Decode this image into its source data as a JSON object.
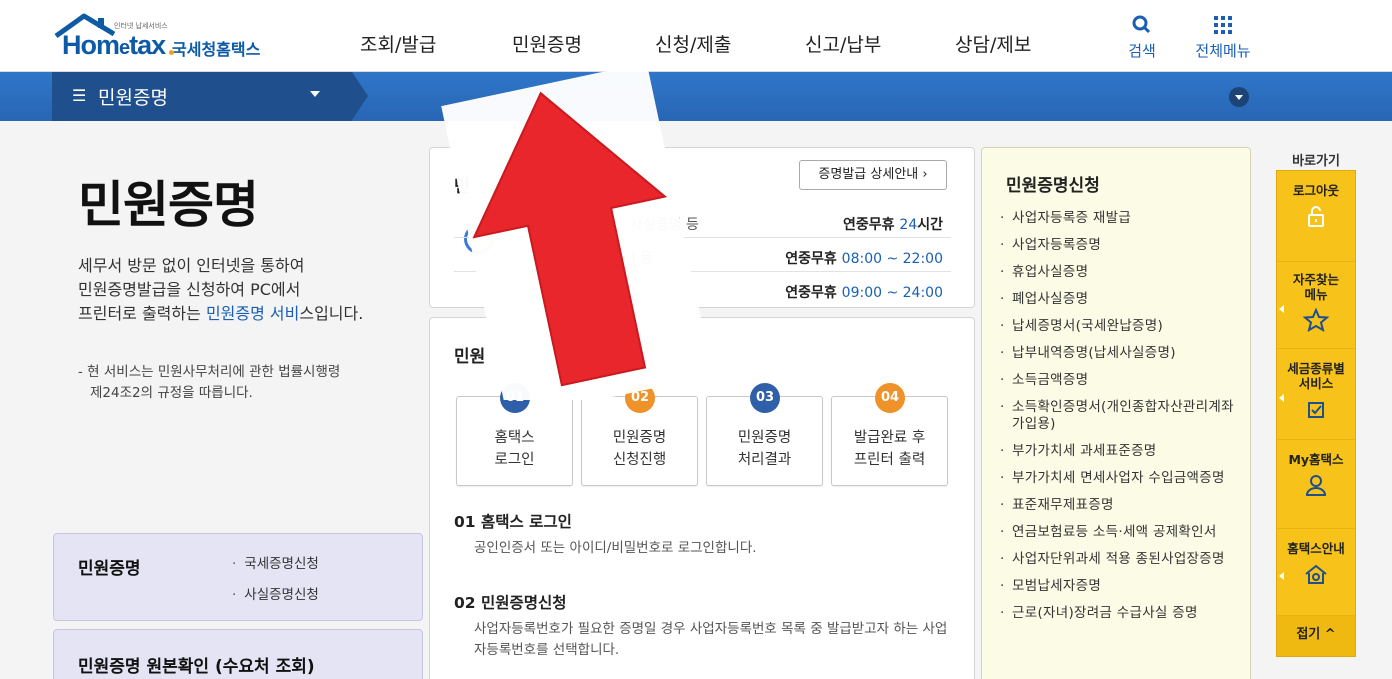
{
  "header": {
    "logo_sub": "인터넷 납세서비스",
    "logo_word": "Hom",
    "logo_e": "e",
    "logo_word2": "tax",
    "logo_kr": "국세청홈택스",
    "nav": [
      "조회/발급",
      "민원증명",
      "신청/제출",
      "신고/납부",
      "상담/제보"
    ],
    "search_label": "검색",
    "menu_label": "전체메뉴"
  },
  "breadcrumb": {
    "label": "민원증명"
  },
  "intro": {
    "title": "민원증명",
    "desc_1": "세무서 방문 없이 인터넷을 통하여",
    "desc_2": "민원증명발급을 신청하여 PC에서",
    "desc_3a": "프린터로 출력하는 ",
    "desc_3b": "민원증명 서비",
    "desc_3c": "스입니다.",
    "note_1": "- 현 서비스는 민원사무처리에 관한 법률시행령",
    "note_2": "제24조2의 규정을 따릅니다."
  },
  "left_boxes": {
    "box1_title": "민원증명",
    "box1_items": [
      "국세증명신청",
      "사실증명신청"
    ],
    "box2_title": "민원증명 원본확인 (수요처 조회)"
  },
  "hours_card": {
    "title": "민",
    "detail_btn": "증명발급 상세안내",
    "rows": [
      {
        "kind": "사실증명 등",
        "prefix": "연중무휴 ",
        "value": "24",
        "suffix": "시간"
      },
      {
        "kind": "] 등",
        "prefix": "연중무휴 ",
        "value": "08:00 ~ 22:00",
        "suffix": ""
      },
      {
        "kind": "",
        "prefix": "연중무휴 ",
        "value": "09:00 ~ 24:00",
        "suffix": ""
      }
    ]
  },
  "steps_card": {
    "title": "민원",
    "steps": [
      {
        "num": "01",
        "line1": "홈택스",
        "line2": "로그인",
        "color": "#2f5fa8"
      },
      {
        "num": "02",
        "line1": "민원증명",
        "line2": "신청진행",
        "color": "#f0922a"
      },
      {
        "num": "03",
        "line1": "민원증명",
        "line2": "처리결과",
        "color": "#2f5fa8"
      },
      {
        "num": "04",
        "line1": "발급완료 후",
        "line2": "프린터 출력",
        "color": "#f0922a"
      }
    ],
    "sec1_title": "01 홈택스 로그인",
    "sec1_text": "공인인증서 또는 아이디/비밀번호로 로그인합니다.",
    "sec2_title": "02 민원증명신청",
    "sec2_text": "사업자등록번호가 필요한 증명일 경우 사업자등록번호 목록 중 발급받고자 하는 사업자등록번호를 선택합니다."
  },
  "right_panel": {
    "title": "민원증명신청",
    "items": [
      "사업자등록증 재발급",
      "사업자등록증명",
      "휴업사실증명",
      "폐업사실증명",
      "납세증명서(국세완납증명)",
      "납부내역증명(납세사실증명)",
      "소득금액증명",
      "소득확인증명서(개인종합자산관리계좌 가입용)",
      "부가가치세 과세표준증명",
      "부가가치세 면세사업자 수입금액증명",
      "표준재무제표증명",
      "연금보험료등 소득·세액 공제확인서",
      "사업자단위과세 적용 종된사업장증명",
      "모범납세자증명",
      "근로(자녀)장려금 수급사실 증명"
    ]
  },
  "quick": {
    "title": "바로가기",
    "logout": "로그아웃",
    "faq_1": "자주찾는",
    "faq_2": "메뉴",
    "tax_1": "세금종류별",
    "tax_2": "서비스",
    "my": "My홈택스",
    "guide": "홈택스안내",
    "fold": "접기 ^"
  },
  "colors": {
    "brand_blue": "#0d5aa6",
    "bar_blue": "#2f76c8",
    "quick_yellow": "#f7c21a",
    "arrow_red": "#e8262b"
  }
}
